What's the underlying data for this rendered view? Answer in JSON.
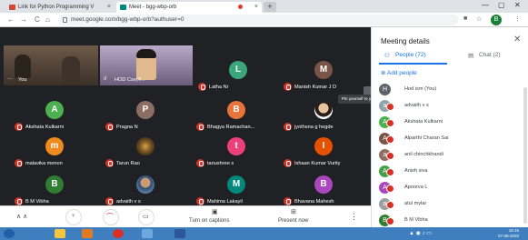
{
  "browser": {
    "tabs": [
      {
        "label": "Link for Python Programming V",
        "icon_color": "#d44638"
      },
      {
        "label": "Meet - bgg-wbp-orb",
        "icon_color": "#00897b"
      }
    ],
    "new_tab": "+",
    "url": "meet.google.com/bgg-wbp-orb?authuser=0",
    "profile_initial": "B"
  },
  "grid": {
    "tiles": [
      {
        "name": "You",
        "type": "video",
        "muted": false
      },
      {
        "name": "HOD Cse(Y...",
        "type": "video",
        "muted": false
      },
      {
        "name": "Latha Nr",
        "initial": "L",
        "color": "#3aa77a",
        "muted": true
      },
      {
        "name": "Manish Kumar J D",
        "initial": "M",
        "color": "#795548",
        "muted": true
      },
      {
        "name": "Akshata Kulkarni",
        "initial": "A",
        "color": "#4caf50",
        "muted": true
      },
      {
        "name": "Pragna N",
        "initial": "P",
        "color": "#8d6e63",
        "muted": true
      },
      {
        "name": "Bhagya Ramachan...",
        "initial": "B",
        "color": "#e8743b",
        "muted": true
      },
      {
        "name": "jyothsna g hegde",
        "type": "photo",
        "muted": true
      },
      {
        "name": "malavika menon",
        "initial": "m",
        "color": "#ef8a1f",
        "muted": true
      },
      {
        "name": "Tarun Rao",
        "type": "photo",
        "muted": true
      },
      {
        "name": "tanushree s",
        "initial": "t",
        "color": "#ec407a",
        "muted": true
      },
      {
        "name": "Ishaan Kumar Vurity",
        "initial": "I",
        "color": "#e65100",
        "muted": true
      },
      {
        "name": "B M Vibha",
        "initial": "B",
        "color": "#2e7d32",
        "muted": true
      },
      {
        "name": "advaith v s",
        "type": "photo",
        "muted": true
      },
      {
        "name": "Mahima Lakayil",
        "initial": "M",
        "color": "#00897b",
        "muted": true
      },
      {
        "name": "Bhavana Mahesh",
        "initial": "B",
        "color": "#ab47bc",
        "muted": true
      }
    ]
  },
  "controls": {
    "captions_label": "Turn on captions",
    "present_label": "Present now",
    "more_label": "⋮"
  },
  "panel": {
    "title": "Meeting details",
    "people_tab": "People (72)",
    "chat_tab": "Chat (2)",
    "add_people": "Add people",
    "tooltip": "Pin yourself to your main screen",
    "people": [
      {
        "name": "Hod ism (You)",
        "initial": "H",
        "color": "#5f6368",
        "muted": false
      },
      {
        "name": "advaith v s",
        "initial": "a",
        "color": "#90a4ae",
        "muted": true
      },
      {
        "name": "Akshata Kulkarni",
        "initial": "A",
        "color": "#4caf50",
        "muted": true
      },
      {
        "name": "Alparthi Charan Sai",
        "initial": "A",
        "color": "#795548",
        "muted": true
      },
      {
        "name": "anil chinchkhandi",
        "initial": "a",
        "color": "#8d6e63",
        "muted": true
      },
      {
        "name": "Anish siva",
        "initial": "A",
        "color": "#43a047",
        "muted": true
      },
      {
        "name": "Apoorva L",
        "initial": "A",
        "color": "#ab47bc",
        "muted": true
      },
      {
        "name": "atul mylar",
        "initial": "a",
        "color": "#9e9e9e",
        "muted": true
      },
      {
        "name": "B M Vibha",
        "initial": "B",
        "color": "#2e7d32",
        "muted": true
      }
    ]
  },
  "taskbar": {
    "time": "16:15",
    "date": "07-08-2020"
  }
}
